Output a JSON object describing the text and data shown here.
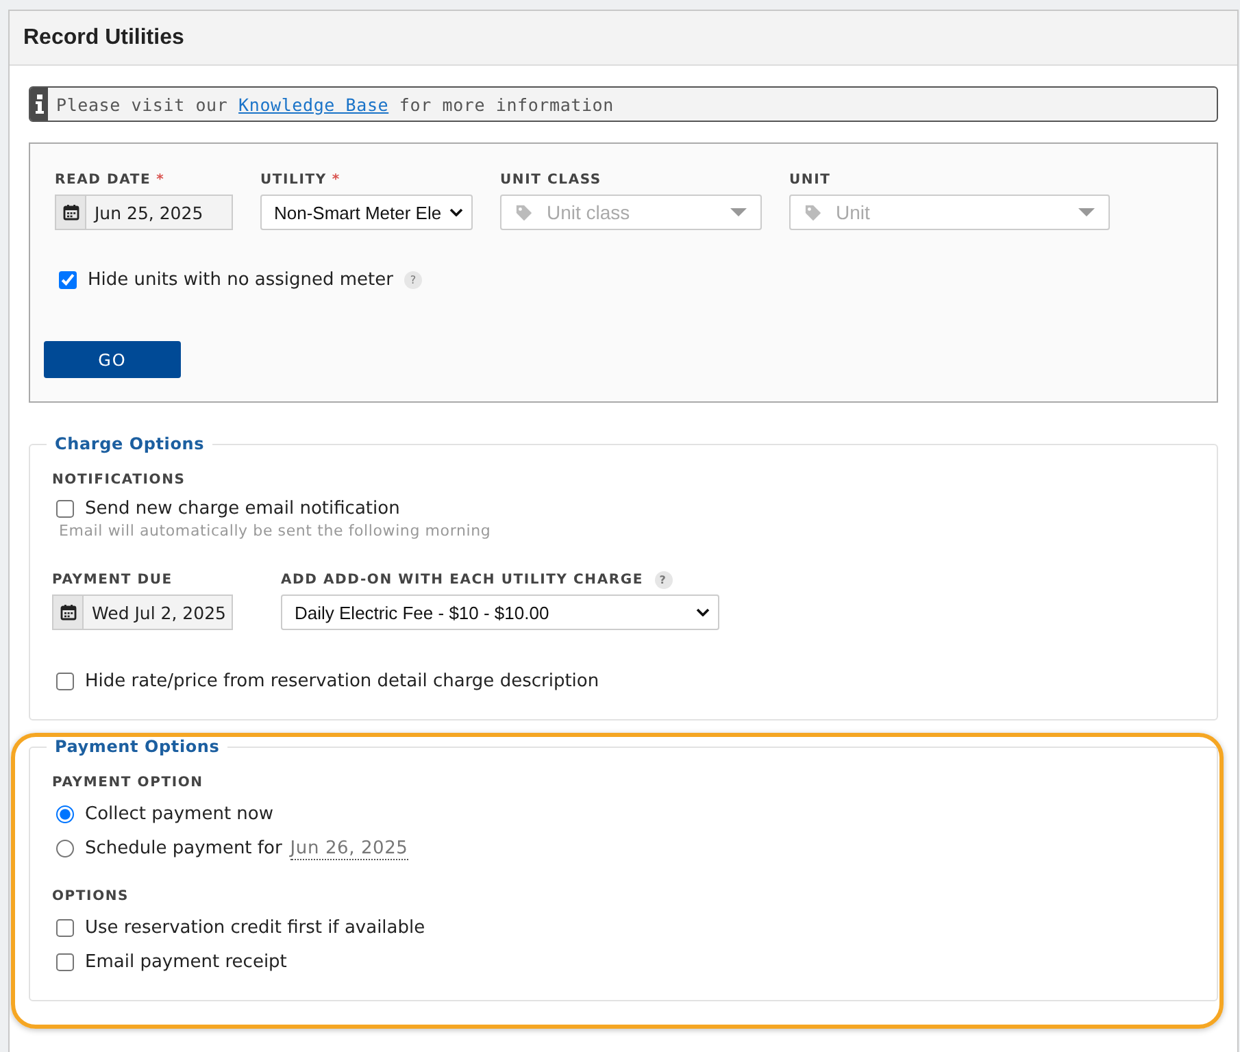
{
  "panel": {
    "title": "Record Utilities"
  },
  "notice": {
    "before": "Please visit our",
    "link": "Knowledge Base",
    "after": "for more information"
  },
  "filters": {
    "read_date": {
      "label": "READ DATE",
      "required_mark": "*",
      "value": "Jun 25, 2025"
    },
    "utility": {
      "label": "UTILITY",
      "required_mark": "*",
      "value": "Non-Smart Meter Ele"
    },
    "unit_class": {
      "label": "UNIT CLASS",
      "placeholder": "Unit class"
    },
    "unit": {
      "label": "UNIT",
      "placeholder": "Unit"
    },
    "hide_units": {
      "label": "Hide units with no assigned meter",
      "checked": true,
      "help": "?"
    },
    "go_button": "GO"
  },
  "charge_options": {
    "legend": "Charge Options",
    "notifications_label": "NOTIFICATIONS",
    "send_email": {
      "label": "Send new charge email notification",
      "checked": false
    },
    "email_hint": "Email will automatically be sent the following morning",
    "payment_due": {
      "label": "PAYMENT DUE",
      "value": "Wed Jul 2, 2025"
    },
    "addon": {
      "label": "ADD ADD-ON WITH EACH UTILITY CHARGE",
      "help": "?",
      "value": "Daily Electric Fee - $10 - $10.00"
    },
    "hide_rate": {
      "label": "Hide rate/price from reservation detail charge description",
      "checked": false
    }
  },
  "payment_options": {
    "legend": "Payment Options",
    "highlighted": true,
    "payment_option_label": "PAYMENT OPTION",
    "choices": [
      {
        "label": "Collect payment now",
        "selected": true
      },
      {
        "label": "Schedule payment for",
        "date": "Jun 26, 2025",
        "selected": false
      }
    ],
    "options_label": "OPTIONS",
    "options": [
      {
        "label": "Use reservation credit first if available",
        "checked": false
      },
      {
        "label": "Email payment receipt",
        "checked": false
      }
    ]
  }
}
